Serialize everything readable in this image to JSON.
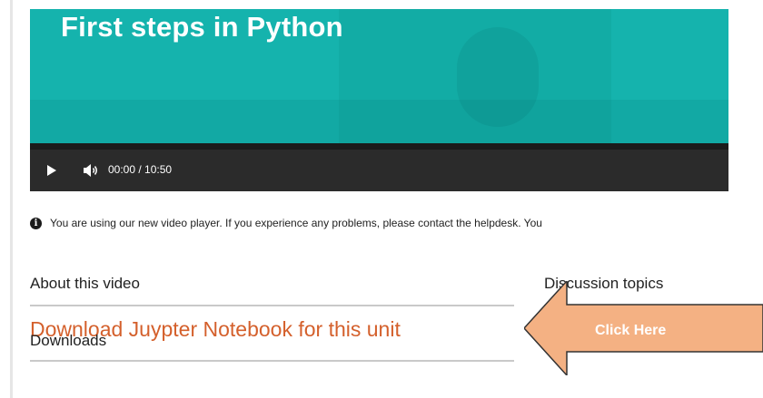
{
  "video": {
    "title": "First steps in Python",
    "time": "00:00 / 10:50",
    "progress": 0
  },
  "notice": {
    "text": "You are using our new video player. If you experience any problems, please contact the helpdesk. You"
  },
  "about": {
    "heading": "About this video",
    "link_text": "Download Juypter Notebook for this unit",
    "downloads_label": "Downloads"
  },
  "discussion": {
    "heading": "Discussion topics"
  },
  "callout": {
    "label": "Click Here"
  },
  "colors": {
    "video_bg": "#15b3ad",
    "link": "#d4602c",
    "callout_fill": "#f4b183",
    "callout_border": "#333333"
  },
  "icons": [
    "play-icon",
    "volume-icon",
    "info-icon",
    "left-arrow-callout"
  ]
}
